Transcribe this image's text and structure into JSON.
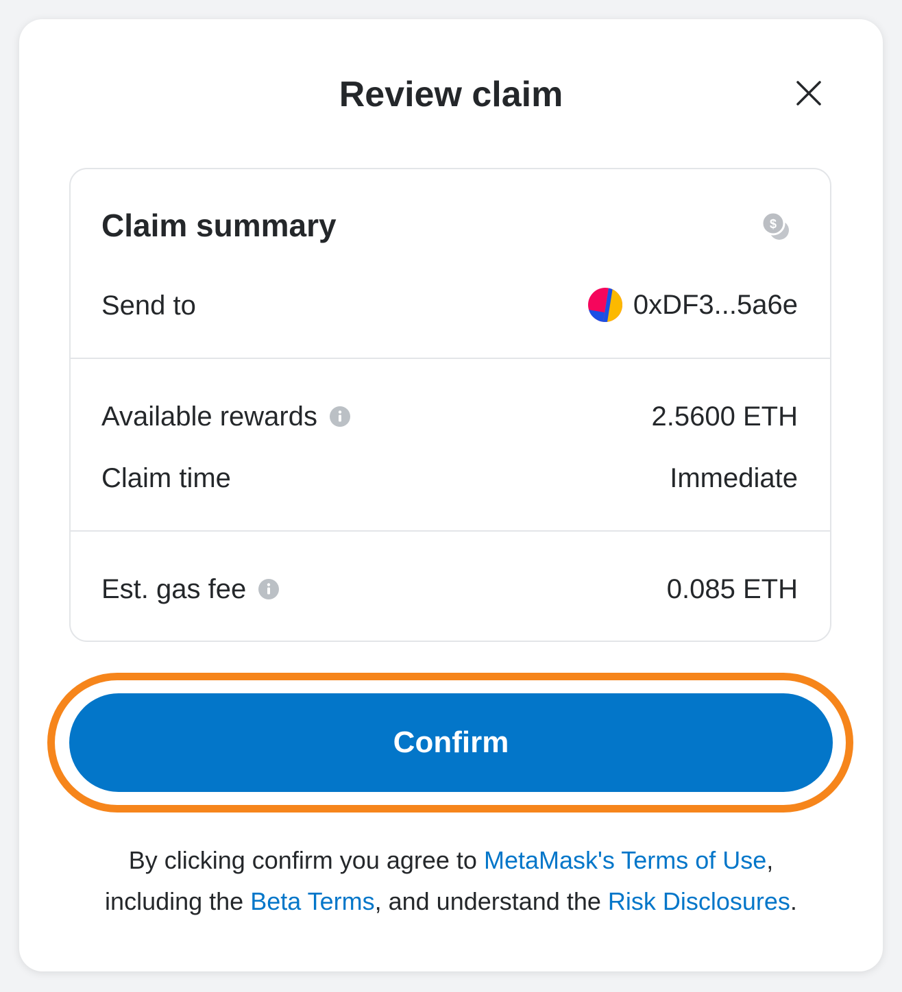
{
  "modal": {
    "title": "Review claim",
    "close_icon": "close-icon"
  },
  "summary": {
    "title": "Claim summary",
    "coins_icon": "coins-icon",
    "send_to": {
      "label": "Send to",
      "address": "0xDF3...5a6e",
      "avatar_icon": "account-avatar-icon"
    },
    "available_rewards": {
      "label": "Available rewards",
      "value": "2.5600 ETH",
      "info_icon": "info-icon"
    },
    "claim_time": {
      "label": "Claim time",
      "value": "Immediate"
    },
    "gas_fee": {
      "label": "Est. gas fee",
      "value": "0.085 ETH",
      "info_icon": "info-icon"
    }
  },
  "confirm": {
    "label": "Confirm",
    "highlight_color": "#f6851b",
    "button_color": "#0376c9"
  },
  "legal": {
    "part1": "By clicking confirm you agree to ",
    "terms_link": "MetaMask's Terms of Use",
    "part2": ",",
    "part3": "including the ",
    "beta_link": "Beta Terms",
    "part4": ", and understand the ",
    "risk_link": "Risk Disclosures",
    "part5": "."
  }
}
